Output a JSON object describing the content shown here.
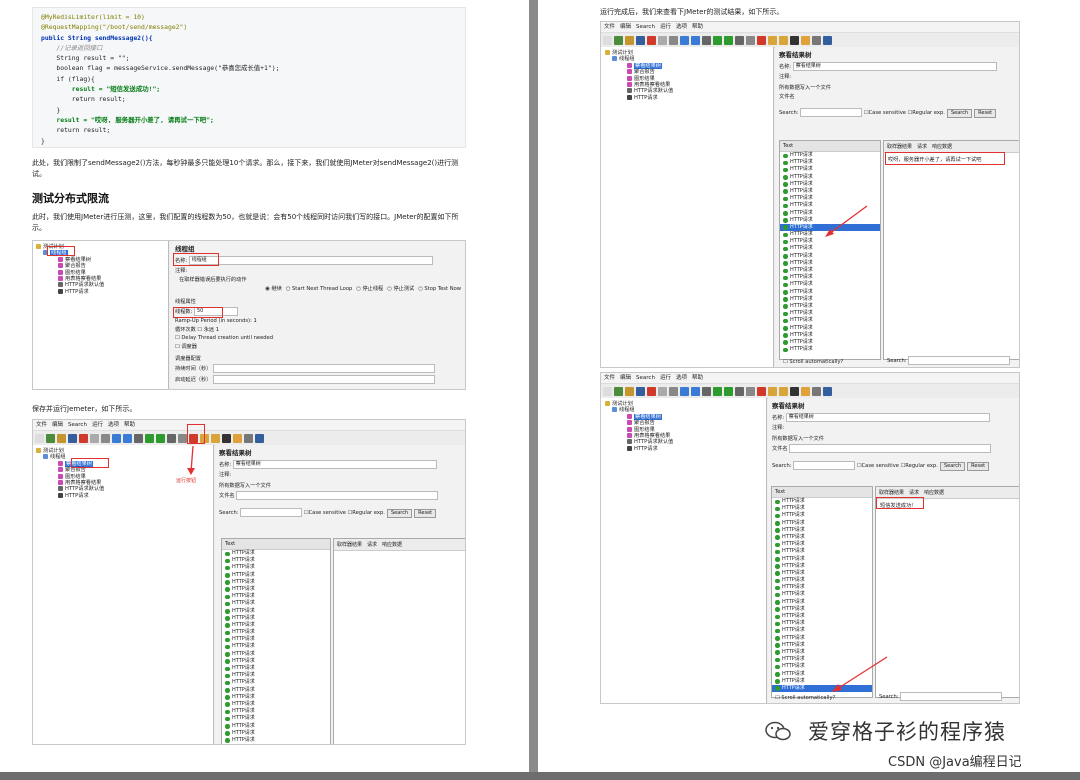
{
  "left_page": {
    "code_lines": [
      {
        "text": "@MyRedisLimiter(limit = 10)",
        "cls": "ann"
      },
      {
        "text": "@RequestMapping(\"/boot/send/message2\")",
        "cls": "ann"
      },
      {
        "text": "public String sendMessage2(){",
        "cls": "kw"
      },
      {
        "text": "    //记录返回接口",
        "cls": "cm"
      },
      {
        "text": "    String result = \"\";",
        "cls": ""
      },
      {
        "text": "    boolean flag = messageService.sendMessage(\"恭喜您成长值+1\");",
        "cls": ""
      },
      {
        "text": "    if (flag){",
        "cls": ""
      },
      {
        "text": "        result = \"短信发送成功!\";",
        "cls": "str"
      },
      {
        "text": "        return result;",
        "cls": ""
      },
      {
        "text": "    }",
        "cls": ""
      },
      {
        "text": "    result = \"哎呀, 服务器开小差了, 请再试一下吧\";",
        "cls": "str"
      },
      {
        "text": "    return result;",
        "cls": ""
      },
      {
        "text": "}",
        "cls": ""
      }
    ],
    "para1": "此处，我们限制了sendMessage2()方法，每秒钟最多只能处理10个请求。那么，接下来，我们就使用JMeter对sendMessage2()进行测试。",
    "heading": "测试分布式限流",
    "para2": "此时，我们使用JMeter进行压测，这里，我们配置的线程数为50，也就是说：会有50个线程同时访问我们写的接口。JMeter的配置如下所示。",
    "para3": "保存并运行Jemeter，如下所示。",
    "shot1": {
      "tree": [
        "测试计划",
        "线程组",
        "察看结果树",
        "聚合报告",
        "图形结果",
        "用表格察看结果",
        "HTTP请求默认值",
        "HTTP请求"
      ],
      "title": "线程组",
      "name_label": "名称:",
      "name_value": "线程组",
      "comment_label": "注释:",
      "error_action": "在取样器错误后要执行的动作",
      "radios": [
        "继续",
        "Start Next Thread Loop",
        "停止线程",
        "停止测试",
        "Stop Test Now"
      ],
      "thread_props": "线程属性",
      "threads_label": "线程数:",
      "threads_value": "50",
      "rampup": "Ramp-Up Period (in seconds):",
      "rampup_value": "1",
      "loop": "循环次数",
      "loop_forever": "永远",
      "loop_value": "1",
      "delay": "Delay Thread creation until needed",
      "scheduler": "调度器",
      "sched_config": "调度器配置",
      "duration": "持续时间（秒）",
      "startup": "启动延迟（秒）"
    },
    "shot2": {
      "menu": [
        "文件",
        "编辑",
        "Search",
        "运行",
        "选项",
        "帮助"
      ],
      "tree": [
        "测试计划",
        "线程组",
        "察看结果树",
        "聚合报告",
        "图形结果",
        "用表格察看结果",
        "HTTP请求默认值",
        "HTTP请求"
      ],
      "run_label": "运行按钮",
      "title": "察看结果树",
      "name_label": "名称:",
      "name_value": "察看结果树",
      "comment_label": "注释:",
      "write_all": "所有数据写入一个文件",
      "filename": "文件名",
      "search": "Search:",
      "case": "Case sensitive",
      "regex": "Regular exp.",
      "search_btn": "Search",
      "reset_btn": "Reset",
      "list_header": "Text",
      "item": "HTTP请求",
      "tabs": [
        "取样器结果",
        "请求",
        "响应数据"
      ]
    }
  },
  "right_page": {
    "intro": "运行完成后，我们来查看下JMeter的测试结果，如下所示。",
    "shot3": {
      "menu": [
        "文件",
        "编辑",
        "Search",
        "运行",
        "选项",
        "帮助"
      ],
      "tree": [
        "测试计划",
        "线程组",
        "察看结果树",
        "聚合报告",
        "图形结果",
        "用表格察看结果",
        "HTTP请求默认值",
        "HTTP请求"
      ],
      "title": "察看结果树",
      "name_label": "名称:",
      "name_value": "察看结果树",
      "comment_label": "注释:",
      "write_all": "所有数据写入一个文件",
      "filename": "文件名",
      "search": "Search:",
      "case": "Case sensitive",
      "regex": "Regular exp.",
      "search_btn": "Search",
      "reset_btn": "Reset",
      "list_header": "Text",
      "item": "HTTP请求",
      "tabs": [
        "取样器结果",
        "请求",
        "响应数据"
      ],
      "response": "哎呀，服务器开小差了，请再试一下试吧",
      "scroll": "Scroll automatically?",
      "search_bottom": "Search:"
    },
    "shot4": {
      "menu": [
        "文件",
        "编辑",
        "Search",
        "运行",
        "选项",
        "帮助"
      ],
      "tree": [
        "测试计划",
        "线程组",
        "察看结果树",
        "聚合报告",
        "图形结果",
        "用表格察看结果",
        "HTTP请求默认值",
        "HTTP请求"
      ],
      "title": "察看结果树",
      "name_label": "名称:",
      "name_value": "察看结果树",
      "comment_label": "注释:",
      "write_all": "所有数据写入一个文件",
      "filename": "文件名",
      "search": "Search:",
      "case": "Case sensitive",
      "regex": "Regular exp.",
      "search_btn": "Search",
      "reset_btn": "Reset",
      "list_header": "Text",
      "item": "HTTP请求",
      "tabs": [
        "取样器结果",
        "请求",
        "响应数据"
      ],
      "response": "短信发送成功!",
      "scroll": "Scroll automatically?",
      "search_bottom": "Search:"
    },
    "watermark_main": "爱穿格子衫的程序猿",
    "watermark_sub": "CSDN @Java编程日记"
  }
}
